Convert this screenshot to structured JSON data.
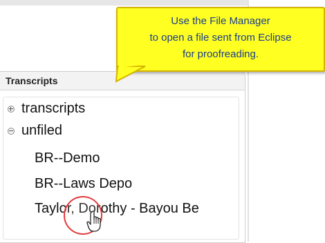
{
  "callout": {
    "line1": "Use the File Manager",
    "line2": "to open a file sent from Eclipse",
    "line3": "for proofreading.",
    "bg_color": "#ffff22",
    "text_color": "#1a3d8f"
  },
  "panel": {
    "title": "Transcripts"
  },
  "tree": {
    "folders": [
      {
        "label": "transcripts",
        "expanded": false
      },
      {
        "label": "unfiled",
        "expanded": true
      }
    ],
    "files": [
      {
        "label": "BR--Demo"
      },
      {
        "label": "BR--Laws Depo"
      },
      {
        "label": "Taylor, Dorothy - Bayou Be"
      }
    ]
  },
  "cursor": {
    "icon": "hand-pointer-icon",
    "highlight_color": "#e4393b"
  }
}
